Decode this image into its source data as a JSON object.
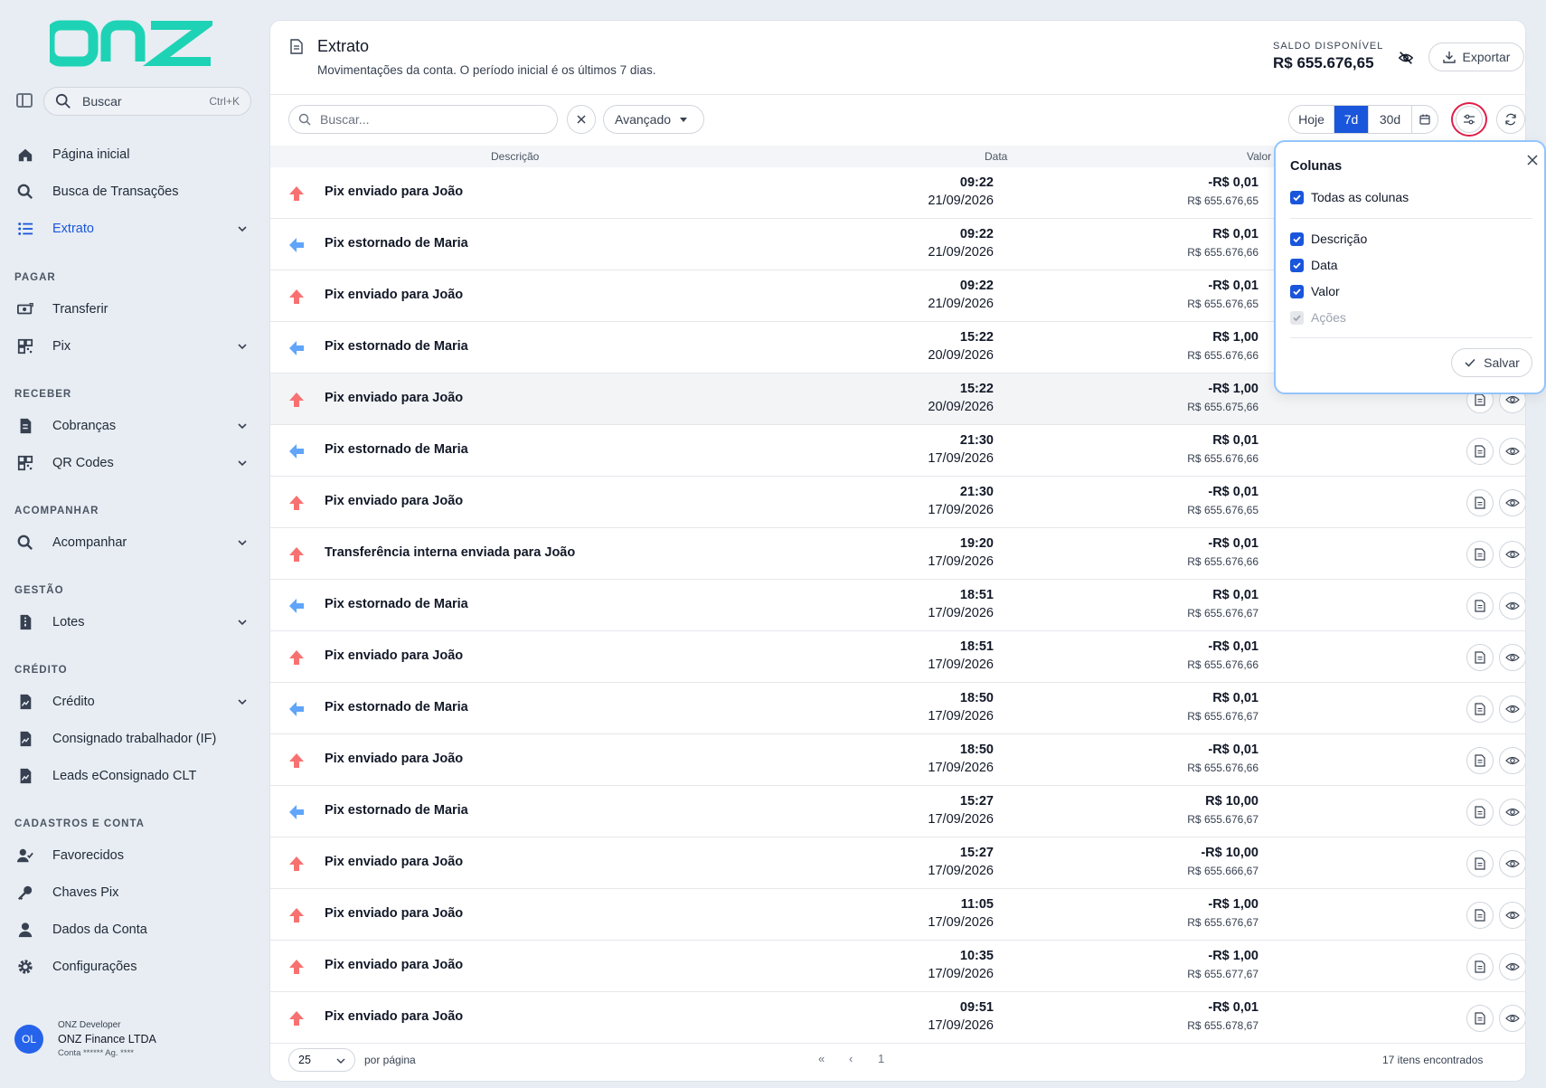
{
  "brand": {
    "logo_text": "onz",
    "logo_color": "#1ed3b5"
  },
  "sidebar": {
    "search_label": "Buscar",
    "search_shortcut": "Ctrl+K",
    "items": [
      {
        "label": "Página inicial",
        "icon": "home-icon"
      },
      {
        "label": "Busca de Transações",
        "icon": "search-icon"
      },
      {
        "label": "Extrato",
        "icon": "list-icon",
        "active": true
      },
      {
        "label": "Transferir",
        "icon": "money-transfer-icon"
      },
      {
        "label": "Pix",
        "icon": "qr-icon"
      },
      {
        "label": "Cobranças",
        "icon": "invoice-icon"
      },
      {
        "label": "QR Codes",
        "icon": "qr-icon"
      },
      {
        "label": "Acompanhar",
        "icon": "search-icon"
      },
      {
        "label": "Lotes",
        "icon": "file-zip-icon"
      },
      {
        "label": "Crédito",
        "icon": "file-chart-icon"
      },
      {
        "label": "Consignado trabalhador (IF)",
        "icon": "file-chart-icon"
      },
      {
        "label": "Leads eConsignado CLT",
        "icon": "file-chart-icon"
      },
      {
        "label": "Favorecidos",
        "icon": "user-check-icon"
      },
      {
        "label": "Chaves Pix",
        "icon": "key-icon"
      },
      {
        "label": "Dados da Conta",
        "icon": "user-icon"
      },
      {
        "label": "Configurações",
        "icon": "gear-icon"
      }
    ],
    "sections": [
      "PAGAR",
      "RECEBER",
      "ACOMPANHAR",
      "GESTÃO",
      "CRÉDITO",
      "CADASTROS E CONTA"
    ],
    "user": {
      "initials": "OL",
      "role": "ONZ Developer",
      "company": "ONZ Finance LTDA",
      "account": "Conta ****** Ag. ****"
    }
  },
  "header": {
    "title": "Extrato",
    "subtitle": "Movimentações da conta. O período inicial é os últimos 7 dias.",
    "balance_label": "SALDO DISPONÍVEL",
    "balance_value": "R$ 655.676,65",
    "export_label": "Exportar"
  },
  "toolbar": {
    "search_placeholder": "Buscar...",
    "advanced_label": "Avançado",
    "periods": [
      "Hoje",
      "7d",
      "30d"
    ],
    "selected_period": "7d"
  },
  "table": {
    "columns": [
      "Descrição",
      "Data",
      "Valor"
    ],
    "rows": [
      {
        "type": "out",
        "desc": "Pix enviado para João",
        "time": "09:22",
        "date": "21/09/2026",
        "value": "-R$ 0,01",
        "balance": "R$ 655.676,65"
      },
      {
        "type": "in",
        "desc": "Pix estornado de Maria",
        "time": "09:22",
        "date": "21/09/2026",
        "value": "R$ 0,01",
        "balance": "R$ 655.676,66"
      },
      {
        "type": "out",
        "desc": "Pix enviado para João",
        "time": "09:22",
        "date": "21/09/2026",
        "value": "-R$ 0,01",
        "balance": "R$ 655.676,65"
      },
      {
        "type": "in",
        "desc": "Pix estornado de Maria",
        "time": "15:22",
        "date": "20/09/2026",
        "value": "R$ 1,00",
        "balance": "R$ 655.676,66"
      },
      {
        "type": "out",
        "desc": "Pix enviado para João",
        "time": "15:22",
        "date": "20/09/2026",
        "value": "-R$ 1,00",
        "balance": "R$ 655.675,66"
      },
      {
        "type": "in",
        "desc": "Pix estornado de Maria",
        "time": "21:30",
        "date": "17/09/2026",
        "value": "R$ 0,01",
        "balance": "R$ 655.676,66"
      },
      {
        "type": "out",
        "desc": "Pix enviado para João",
        "time": "21:30",
        "date": "17/09/2026",
        "value": "-R$ 0,01",
        "balance": "R$ 655.676,65"
      },
      {
        "type": "out",
        "desc": "Transferência interna enviada para João",
        "time": "19:20",
        "date": "17/09/2026",
        "value": "-R$ 0,01",
        "balance": "R$ 655.676,66"
      },
      {
        "type": "in",
        "desc": "Pix estornado de Maria",
        "time": "18:51",
        "date": "17/09/2026",
        "value": "R$ 0,01",
        "balance": "R$ 655.676,67"
      },
      {
        "type": "out",
        "desc": "Pix enviado para João",
        "time": "18:51",
        "date": "17/09/2026",
        "value": "-R$ 0,01",
        "balance": "R$ 655.676,66"
      },
      {
        "type": "in",
        "desc": "Pix estornado de Maria",
        "time": "18:50",
        "date": "17/09/2026",
        "value": "R$ 0,01",
        "balance": "R$ 655.676,67"
      },
      {
        "type": "out",
        "desc": "Pix enviado para João",
        "time": "18:50",
        "date": "17/09/2026",
        "value": "-R$ 0,01",
        "balance": "R$ 655.676,66"
      },
      {
        "type": "in",
        "desc": "Pix estornado de Maria",
        "time": "15:27",
        "date": "17/09/2026",
        "value": "R$ 10,00",
        "balance": "R$ 655.676,67"
      },
      {
        "type": "out",
        "desc": "Pix enviado para João",
        "time": "15:27",
        "date": "17/09/2026",
        "value": "-R$ 10,00",
        "balance": "R$ 655.666,67"
      },
      {
        "type": "out",
        "desc": "Pix enviado para João",
        "time": "11:05",
        "date": "17/09/2026",
        "value": "-R$ 1,00",
        "balance": "R$ 655.676,67"
      },
      {
        "type": "out",
        "desc": "Pix enviado para João",
        "time": "10:35",
        "date": "17/09/2026",
        "value": "-R$ 1,00",
        "balance": "R$ 655.677,67"
      },
      {
        "type": "out",
        "desc": "Pix enviado para João",
        "time": "09:51",
        "date": "17/09/2026",
        "value": "-R$ 0,01",
        "balance": "R$ 655.678,67"
      }
    ]
  },
  "footer": {
    "per_page_value": "25",
    "per_page_label": "por página",
    "current_page": "1",
    "found_label": "17 itens encontrados"
  },
  "columns_popover": {
    "title": "Colunas",
    "all_label": "Todas as colunas",
    "options": [
      {
        "label": "Descrição",
        "checked": true,
        "disabled": false
      },
      {
        "label": "Data",
        "checked": true,
        "disabled": false
      },
      {
        "label": "Valor",
        "checked": true,
        "disabled": false
      },
      {
        "label": "Ações",
        "checked": true,
        "disabled": true
      }
    ],
    "save_label": "Salvar"
  },
  "colors": {
    "accent": "#1a56db",
    "out_arrow": "#f87171",
    "in_arrow": "#60a5fa",
    "highlight_ring": "#e11d48"
  }
}
